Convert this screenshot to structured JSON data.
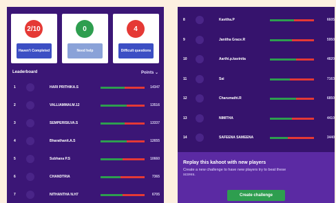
{
  "stats": [
    {
      "value": "2/10",
      "label": "Haven't Completed",
      "circle_color": "#e53935",
      "label_color": "#3c4fc4"
    },
    {
      "value": "0",
      "label": "Need help",
      "circle_color": "#2e9e4f",
      "label_color": "#8aa2d8"
    },
    {
      "value": "4",
      "label": "Difficult questions",
      "circle_color": "#e53935",
      "label_color": "#3c4fc4"
    }
  ],
  "leaderboard": {
    "title": "Leaderboard",
    "sort_label": "Points"
  },
  "left_rows": [
    {
      "rank": "1",
      "name": "HARI PRITHIKA.S",
      "score": "14347",
      "progress": 0.55
    },
    {
      "rank": "2",
      "name": "VALLIAMMAI.M.12",
      "score": "13516",
      "progress": 0.6
    },
    {
      "rank": "3",
      "name": "SEMPERISILVA.S",
      "score": "13337",
      "progress": 0.55
    },
    {
      "rank": "4",
      "name": "Bharathanit.A.S",
      "score": "12655",
      "progress": 0.6
    },
    {
      "rank": "5",
      "name": "Subhana P.S",
      "score": "10660",
      "progress": 0.5
    },
    {
      "rank": "6",
      "name": "CHANDTRIA",
      "score": "7365",
      "progress": 0.45
    },
    {
      "rank": "7",
      "name": "NITHANTHA N.H7",
      "score": "6705",
      "progress": 0.5
    }
  ],
  "right_rows": [
    {
      "rank": "8",
      "name": "Kavitha.P",
      "score": "6605",
      "progress": 0.55
    },
    {
      "rank": "9",
      "name": "Janitha Grace.R",
      "score": "5950",
      "progress": 0.5
    },
    {
      "rank": "10",
      "name": "Aarthi.p.kavinita",
      "score": "4820",
      "progress": 0.6
    },
    {
      "rank": "11",
      "name": "Sai",
      "score": "7163",
      "progress": 0.45
    },
    {
      "rank": "12",
      "name": "Charumathi.R",
      "score": "6850",
      "progress": 0.6
    },
    {
      "rank": "13",
      "name": "NIMITHA",
      "score": "4410",
      "progress": 0.5
    },
    {
      "rank": "14",
      "name": "SAFEENA SAMEENA",
      "score": "3440",
      "progress": 0.4
    }
  ],
  "replay": {
    "title": "Replay this kahoot with new players",
    "description": "Create a new challenge to have new players try to beat these scores.",
    "button_label": "Create challenge"
  }
}
